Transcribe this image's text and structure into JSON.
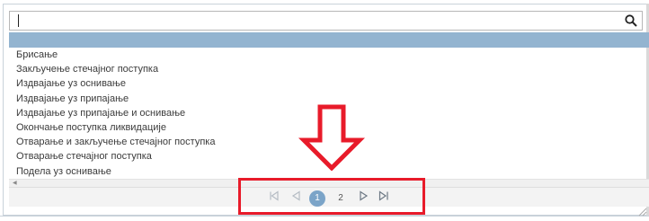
{
  "search": {
    "value": "",
    "placeholder": "",
    "icon": "search-icon"
  },
  "list": {
    "items": [
      "Брисање",
      "Закључење стечајног поступка",
      "Издвајање уз оснивање",
      "Издвајање уз припајање",
      "Издвајање уз припајање и оснивање",
      "Окончање поступка ликвидације",
      "Отварање и закључење стечајног поступка",
      "Отварање стечајног поступка",
      "Подела уз оснивање"
    ]
  },
  "pager": {
    "first_icon": "first-page-icon",
    "prev_icon": "previous-page-icon",
    "pages": [
      "1",
      "2"
    ],
    "current_page": "1",
    "next_icon": "next-page-icon",
    "last_icon": "last-page-icon"
  },
  "colors": {
    "selection_bar": "#93b4d0",
    "active_page": "#7ba4c8",
    "annotation_red": "#e81b2a"
  }
}
